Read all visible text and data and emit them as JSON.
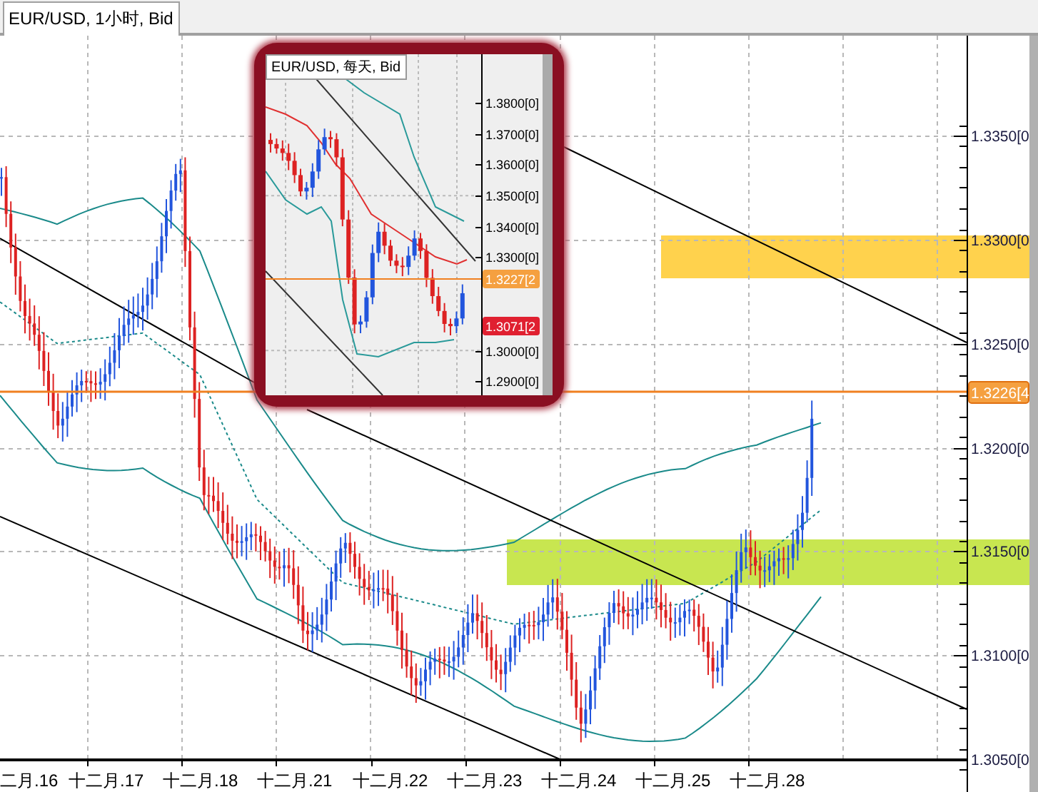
{
  "chart_tab": {
    "title": "EUR/USD, 1小时, Bid"
  },
  "main_chart": {
    "price_labels": [
      "1.3350[0",
      "1.3300[0",
      "1.3250[0",
      "1.3200[0",
      "1.3150[0",
      "1.3100[0",
      "1.3050[0"
    ],
    "current_price": "1.3226[4",
    "date_labels": [
      "二月.16",
      "十二月.17",
      "十二月.18",
      "十二月.21",
      "十二月.22",
      "十二月.23",
      "十二月.24",
      "十二月.25",
      "十二月.28"
    ],
    "zones": [
      {
        "kind": "resistance",
        "color": "#ffd24d"
      },
      {
        "kind": "support",
        "color": "#c8e650"
      }
    ]
  },
  "inset_chart": {
    "title": "EUR/USD, 每天, Bid",
    "price_labels": [
      "1.3800[0]",
      "1.3700[0]",
      "1.3600[0]",
      "1.3500[0]",
      "1.3400[0]",
      "1.3300[0]",
      "1.3000[0]",
      "1.2900[0]"
    ],
    "current_price": "1.3227[2",
    "low_price": "1.3071[2"
  }
}
